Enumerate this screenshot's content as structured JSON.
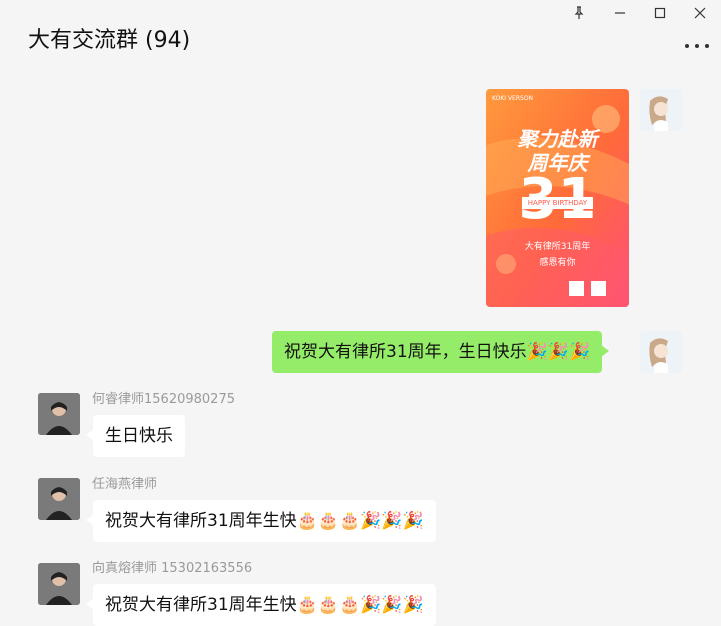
{
  "window": {
    "title": "大有交流群 (94)",
    "controls": [
      "pin-icon",
      "minimize-icon",
      "maximize-icon",
      "close-icon"
    ]
  },
  "poster": {
    "top_small_text": "KOKI VERSON",
    "headline_1": "聚力赴新",
    "headline_2": "周年庆",
    "number": "31",
    "banner": "HAPPY BIRTHDAY",
    "line_1": "大有律所31周年",
    "line_2": "感恩有你"
  },
  "messages": [
    {
      "side": "self",
      "text": "祝贺大有律所31周年，生日快乐🎉🎉🎉"
    },
    {
      "side": "other",
      "sender": "何睿律师15620980275",
      "text": "生日快乐"
    },
    {
      "side": "other",
      "sender": "任海燕律师",
      "text": "祝贺大有律所31周年生快🎂🎂🎂🎉🎉🎉"
    },
    {
      "side": "other",
      "sender": "向真熔律师  15302163556",
      "text": "祝贺大有律所31周年生快🎂🎂🎂🎉🎉🎉"
    }
  ],
  "colors": {
    "background": "#f5f5f5",
    "self_bubble": "#95ec69",
    "other_bubble": "#ffffff",
    "poster_orange": "#ff7a3c",
    "poster_pink": "#ff4f7b"
  }
}
